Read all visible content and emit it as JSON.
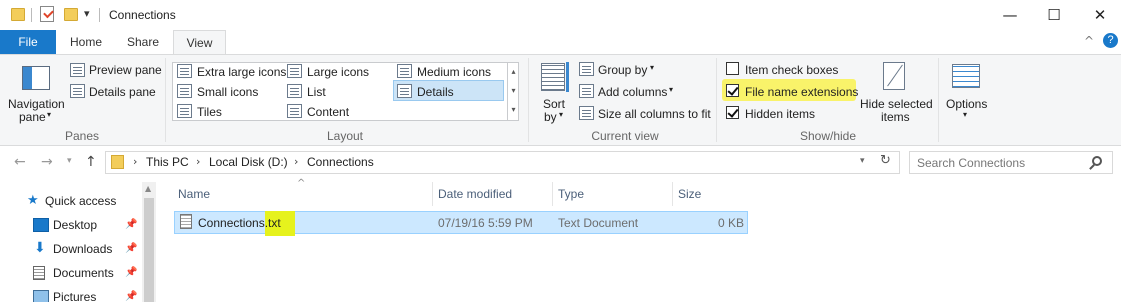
{
  "window": {
    "title": "Connections",
    "minimize_glyph": "—",
    "maximize_glyph": "☐",
    "close_glyph": "✕",
    "qat_dropdown_glyph": "▾"
  },
  "tabs": [
    "File",
    "Home",
    "Share",
    "View"
  ],
  "ribbon_corner": {
    "collapse_glyph": "^",
    "help_glyph": "?"
  },
  "ribbon": {
    "panes": {
      "label": "Panes",
      "navigation_pane_line1": "Navigation",
      "navigation_pane_line2": "pane",
      "preview_pane": "Preview pane",
      "details_pane": "Details pane"
    },
    "layout": {
      "label": "Layout",
      "items": [
        "Extra large icons",
        "Large icons",
        "Medium icons",
        "Small icons",
        "List",
        "Details",
        "Tiles",
        "Content"
      ],
      "selected": "Details"
    },
    "current_view": {
      "label": "Current view",
      "sort_by_line1": "Sort",
      "sort_by_line2": "by",
      "group_by": "Group by",
      "add_columns": "Add columns",
      "size_all_columns": "Size all columns to fit"
    },
    "show_hide": {
      "label": "Show/hide",
      "item_check_boxes": "Item check boxes",
      "item_check_boxes_checked": false,
      "file_name_extensions": "File name extensions",
      "file_name_extensions_checked": true,
      "hidden_items": "Hidden items",
      "hidden_items_checked": true,
      "hide_selected_line1": "Hide selected",
      "hide_selected_line2": "items",
      "highlight_color": "#f9f36a"
    },
    "options": {
      "label": "Options"
    }
  },
  "address": {
    "crumbs": [
      "This PC",
      "Local Disk (D:)",
      "Connections"
    ],
    "search_placeholder": "Search Connections"
  },
  "nav_pane": {
    "items": [
      {
        "label": "Quick access",
        "icon": "star-icon",
        "pinned": false
      },
      {
        "label": "Desktop",
        "icon": "desktop-icon",
        "pinned": true
      },
      {
        "label": "Downloads",
        "icon": "download-icon",
        "pinned": true
      },
      {
        "label": "Documents",
        "icon": "documents-icon",
        "pinned": true
      },
      {
        "label": "Pictures",
        "icon": "pictures-icon",
        "pinned": true
      }
    ]
  },
  "file_list": {
    "columns": [
      "Name",
      "Date modified",
      "Type",
      "Size"
    ],
    "sort_indicator": "^",
    "rows": [
      {
        "name": "Connections.txt",
        "date_modified": "07/19/16 5:59 PM",
        "type": "Text Document",
        "size": "0 KB"
      }
    ]
  },
  "colors": {
    "accent": "#1979ca",
    "selection": "#cce8ff",
    "extension_highlight": "#e6f21d"
  }
}
